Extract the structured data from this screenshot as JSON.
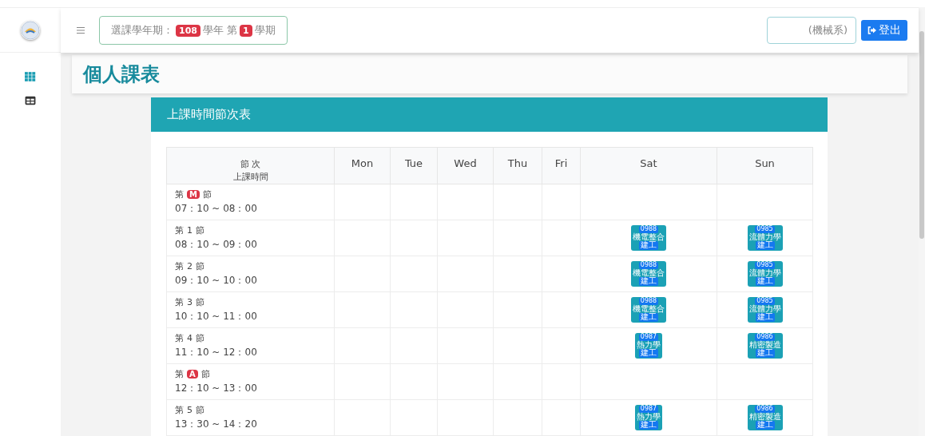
{
  "topbar": {
    "term_label": "選課學年期：",
    "year": "108",
    "year_unit": "學年 第",
    "semester": "1",
    "semester_unit": "學期",
    "dept_field": {
      "value": "(機械系)"
    },
    "logout_button": "登出"
  },
  "page_title": "個人課表",
  "schedule": {
    "title": "上課時間節次表",
    "columns": [
      {
        "kind": "period",
        "line1": "節 次",
        "line2": "上課時間"
      },
      {
        "kind": "day",
        "label": "Mon"
      },
      {
        "kind": "day",
        "label": "Tue"
      },
      {
        "kind": "day",
        "label": "Wed"
      },
      {
        "kind": "day",
        "label": "Thu"
      },
      {
        "kind": "day",
        "label": "Fri"
      },
      {
        "kind": "day",
        "label": "Sat"
      },
      {
        "kind": "day",
        "label": "Sun"
      }
    ],
    "rows": [
      {
        "cells": [
          {
            "kind": "period",
            "prefix": "第",
            "period": "M",
            "badge": true,
            "suffix": "節",
            "time": "07：10 ~ 08：00"
          },
          "",
          "",
          "",
          "",
          "",
          "",
          ""
        ]
      },
      {
        "cells": [
          {
            "kind": "period",
            "prefix": "第",
            "period": "1",
            "badge": false,
            "suffix": "節",
            "time": "08：10 ~ 09：00"
          },
          "",
          "",
          "",
          "",
          "",
          {
            "kind": "course",
            "code": "0988",
            "name": "機電整合",
            "tag": "建工"
          },
          {
            "kind": "course",
            "code": "0985",
            "name": "流體力學",
            "tag": "建工"
          }
        ]
      },
      {
        "cells": [
          {
            "kind": "period",
            "prefix": "第",
            "period": "2",
            "badge": false,
            "suffix": "節",
            "time": "09：10 ~ 10：00"
          },
          "",
          "",
          "",
          "",
          "",
          {
            "kind": "course",
            "code": "0988",
            "name": "機電整合",
            "tag": "建工"
          },
          {
            "kind": "course",
            "code": "0985",
            "name": "流體力學",
            "tag": "建工"
          }
        ]
      },
      {
        "cells": [
          {
            "kind": "period",
            "prefix": "第",
            "period": "3",
            "badge": false,
            "suffix": "節",
            "time": "10：10 ~ 11：00"
          },
          "",
          "",
          "",
          "",
          "",
          {
            "kind": "course",
            "code": "0988",
            "name": "機電整合",
            "tag": "建工"
          },
          {
            "kind": "course",
            "code": "0985",
            "name": "流體力學",
            "tag": "建工"
          }
        ]
      },
      {
        "cells": [
          {
            "kind": "period",
            "prefix": "第",
            "period": "4",
            "badge": false,
            "suffix": "節",
            "time": "11：10 ~ 12：00"
          },
          "",
          "",
          "",
          "",
          "",
          {
            "kind": "course",
            "code": "0987",
            "name": "熱力學",
            "tag": "建工"
          },
          {
            "kind": "course",
            "code": "0986",
            "name": "精密製造",
            "tag": "建工"
          }
        ]
      },
      {
        "cells": [
          {
            "kind": "period",
            "prefix": "第",
            "period": "A",
            "badge": true,
            "suffix": "節",
            "time": "12：10 ~ 13：00"
          },
          "",
          "",
          "",
          "",
          "",
          "",
          ""
        ]
      },
      {
        "cells": [
          {
            "kind": "period",
            "prefix": "第",
            "period": "5",
            "badge": false,
            "suffix": "節",
            "time": "13：30 ~ 14：20"
          },
          "",
          "",
          "",
          "",
          "",
          {
            "kind": "course",
            "code": "0987",
            "name": "熱力學",
            "tag": "建工"
          },
          {
            "kind": "course",
            "code": "0986",
            "name": "精密製造",
            "tag": "建工"
          }
        ]
      }
    ]
  }
}
